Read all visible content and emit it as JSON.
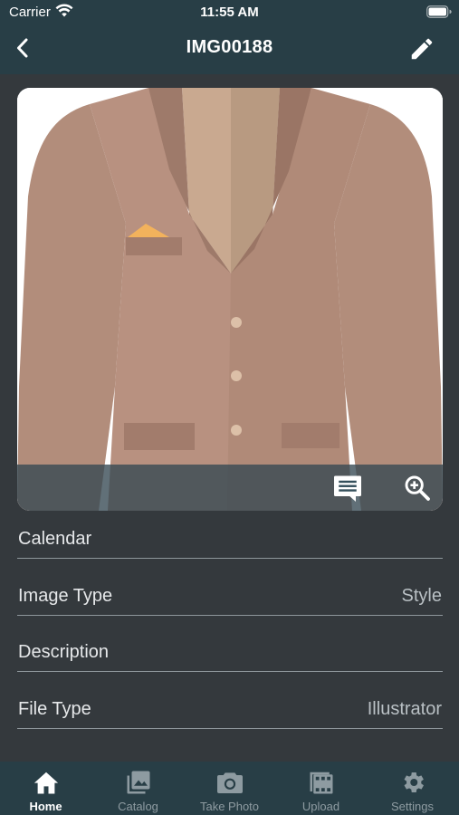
{
  "status_bar": {
    "carrier": "Carrier",
    "time": "11:55 AM"
  },
  "nav": {
    "title": "IMG00188",
    "back_icon": "chevron-left-icon",
    "edit_icon": "pencil-icon"
  },
  "image": {
    "subject": "jacket-illustration",
    "actions": [
      {
        "icon": "comment-icon"
      },
      {
        "icon": "zoom-in-icon"
      }
    ]
  },
  "fields": [
    {
      "label": "Calendar",
      "value": ""
    },
    {
      "label": "Image Type",
      "value": "Style"
    },
    {
      "label": "Description",
      "value": ""
    },
    {
      "label": "File Type",
      "value": "Illustrator"
    }
  ],
  "tabs": [
    {
      "label": "Home",
      "icon": "home-icon",
      "active": true
    },
    {
      "label": "Catalog",
      "icon": "photo-gallery-icon",
      "active": false
    },
    {
      "label": "Take Photo",
      "icon": "camera-icon",
      "active": false
    },
    {
      "label": "Upload",
      "icon": "upload-icon",
      "active": false
    },
    {
      "label": "Settings",
      "icon": "gear-icon",
      "active": false
    }
  ],
  "colors": {
    "background": "#34393d",
    "bar": "#283e46",
    "accent": "#ffffff"
  }
}
